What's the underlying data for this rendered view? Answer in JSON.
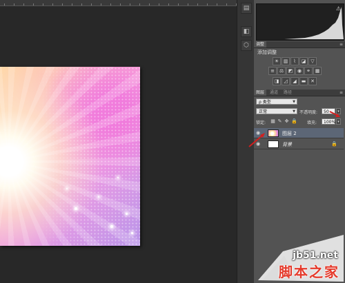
{
  "colors": {
    "workspace": "#282828",
    "panel": "#535353",
    "selected_layer": "#5c6676",
    "arrow": "#d21e1e",
    "watermark_red": "#e53a2b"
  },
  "strip": {
    "icons": [
      "layers-stack-icon",
      "mask-icon",
      "cube-icon"
    ]
  },
  "histogram": {
    "warning_icon": "warning-icon"
  },
  "adjustments": {
    "tab": "调整",
    "title": "添加调整",
    "row1_icons": [
      "brightness-icon",
      "levels-icon",
      "curves-icon",
      "exposure-icon",
      "vibrance-triangle-icon"
    ],
    "row2_icons": [
      "hue-saturation-icon",
      "color-balance-icon",
      "black-white-icon",
      "photo-filter-icon",
      "channel-mixer-icon",
      "color-lookup-icon"
    ],
    "row3_icons": [
      "invert-icon",
      "posterize-icon",
      "threshold-icon",
      "gradient-map-icon",
      "selective-color-icon"
    ]
  },
  "layers_panel": {
    "tabs": [
      "图层",
      "通道",
      "路径"
    ],
    "filter_label": "ρ 类型",
    "blend_mode": "正常",
    "opacity_label": "不透明度:",
    "opacity_value": "50",
    "lock_label": "锁定:",
    "fill_label": "填充:",
    "fill_value": "100%",
    "layers": [
      {
        "name": "图层 2",
        "selected": true,
        "visible": true
      },
      {
        "name": "背景",
        "selected": false,
        "visible": true,
        "locked": true
      }
    ]
  },
  "watermark": {
    "site": "jb51.net",
    "name": "脚本之家"
  }
}
